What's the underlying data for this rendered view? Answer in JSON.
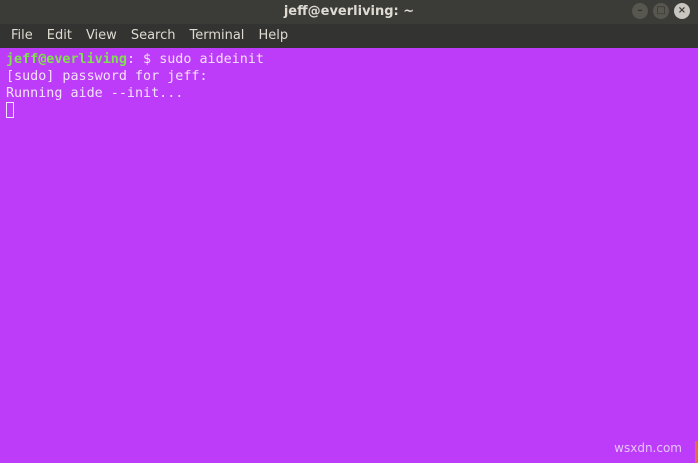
{
  "window": {
    "title": "jeff@everliving: ~",
    "controls": {
      "minimize": "–",
      "maximize": "□",
      "close": "×"
    }
  },
  "menubar": {
    "items": [
      "File",
      "Edit",
      "View",
      "Search",
      "Terminal",
      "Help"
    ]
  },
  "terminal": {
    "prompt_user": "jeff@everliving",
    "prompt_sep": ":",
    "prompt_rest": " $ ",
    "command": "sudo aideinit",
    "lines": [
      "[sudo] password for jeff:",
      "Running aide --init..."
    ],
    "background": "#bd3cf9",
    "prompt_color": "#7ee24f"
  },
  "watermark": "wsxdn.com"
}
